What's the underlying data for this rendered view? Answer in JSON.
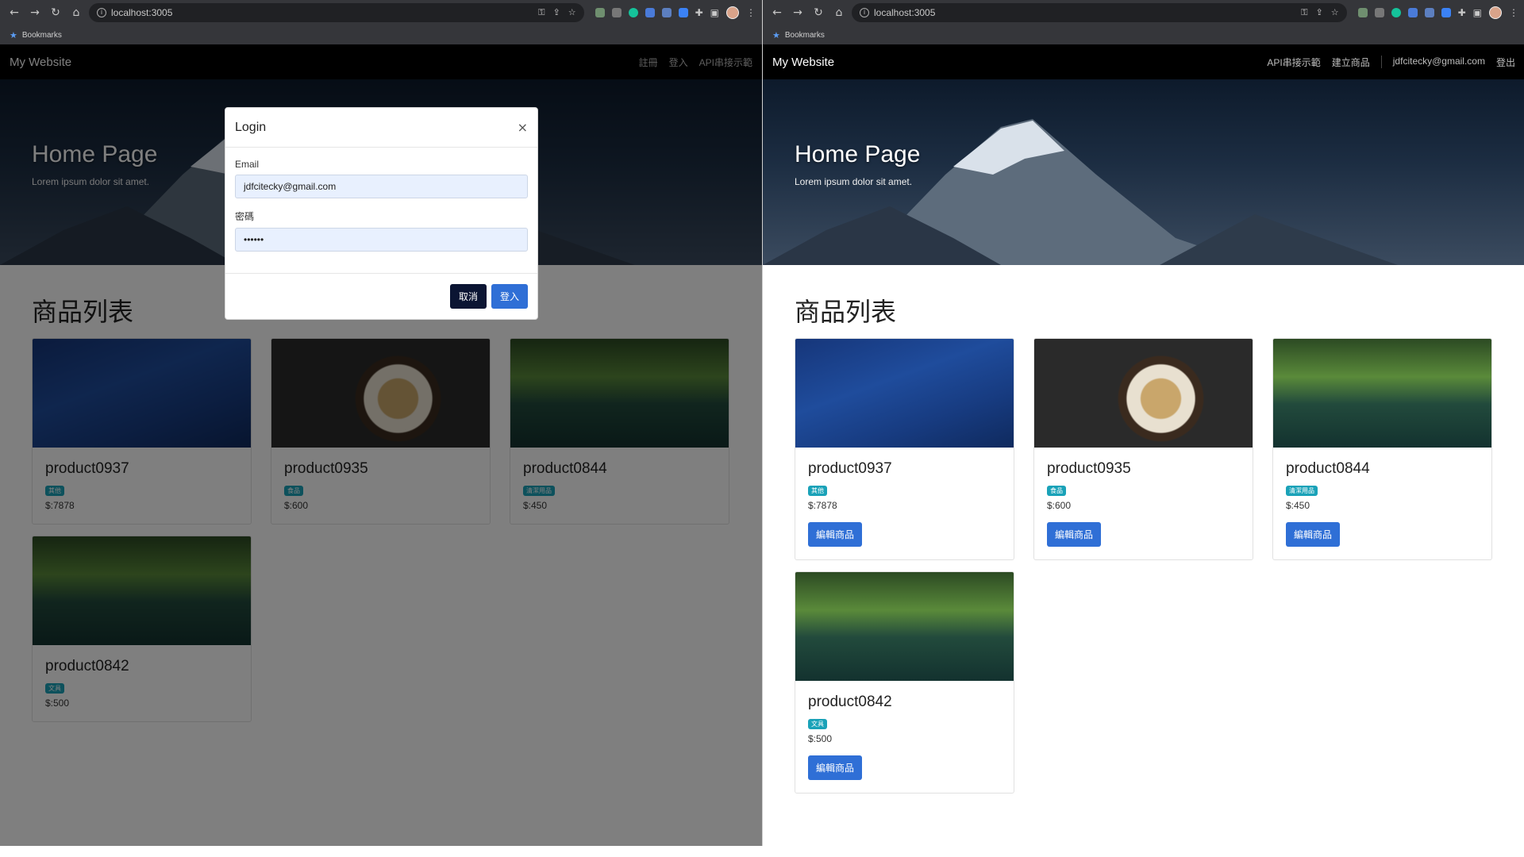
{
  "browser": {
    "url": "localhost:3005",
    "bookmarks_label": "Bookmarks"
  },
  "left": {
    "brand": "My Website",
    "nav": [
      "註冊",
      "登入",
      "API串接示範"
    ],
    "hero_title": "Home Page",
    "hero_subtitle": "Lorem ipsum dolor sit amet.",
    "section_title": "商品列表",
    "products": [
      {
        "name": "product0937",
        "category": "其他",
        "price": "$:7878"
      },
      {
        "name": "product0935",
        "category": "食品",
        "price": "$:600"
      },
      {
        "name": "product0844",
        "category": "清潔用品",
        "price": "$:450"
      },
      {
        "name": "product0842",
        "category": "文具",
        "price": "$:500"
      }
    ],
    "modal": {
      "title": "Login",
      "close": "×",
      "email_label": "Email",
      "email_value": "jdfcitecky@gmail.com",
      "password_label": "密碼",
      "password_value": "••••••",
      "cancel": "取消",
      "submit": "登入"
    }
  },
  "right": {
    "brand": "My Website",
    "nav": [
      "API串接示範",
      "建立商品",
      "jdfcitecky@gmail.com",
      "登出"
    ],
    "hero_title": "Home Page",
    "hero_subtitle": "Lorem ipsum dolor sit amet.",
    "section_title": "商品列表",
    "edit_label": "編輯商品",
    "products": [
      {
        "name": "product0937",
        "category": "其他",
        "price": "$:7878"
      },
      {
        "name": "product0935",
        "category": "食品",
        "price": "$:600"
      },
      {
        "name": "product0844",
        "category": "清潔用品",
        "price": "$:450"
      },
      {
        "name": "product0842",
        "category": "文具",
        "price": "$:500"
      }
    ]
  },
  "colors": {
    "primary": "#2f6fd6",
    "dark": "#0b1533",
    "badge": "#1aa2b8",
    "navbar": "#000000"
  }
}
